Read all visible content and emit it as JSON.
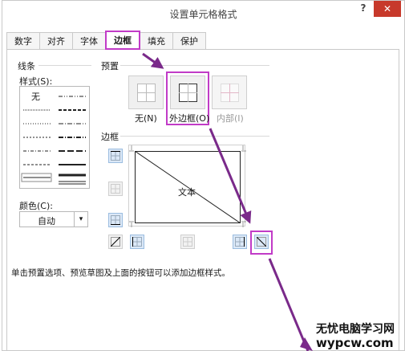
{
  "window": {
    "title": "设置单元格格式",
    "help": "?",
    "close": "✕"
  },
  "tabs": [
    {
      "label": "数字"
    },
    {
      "label": "对齐"
    },
    {
      "label": "字体"
    },
    {
      "label": "边框",
      "active": true
    },
    {
      "label": "填充"
    },
    {
      "label": "保护"
    }
  ],
  "line": {
    "group_label": "线条",
    "style_label": "样式(S):",
    "none_label": "无",
    "color_label": "颜色(C):",
    "color_value": "自动"
  },
  "preset": {
    "group_label": "预置",
    "none": "无(N)",
    "outline": "外边框(O)",
    "inside": "内部(I)"
  },
  "border": {
    "group_label": "边框",
    "preview_text": "文本"
  },
  "hint": "单击预置选项、预览草图及上面的按钮可以添加边框样式。",
  "watermark": {
    "name": "无忧电脑学习网",
    "url": "wypcw.com"
  },
  "colors": {
    "highlight": "#c13bc7",
    "arrow": "#7a2a8a",
    "close": "#c7392b"
  }
}
